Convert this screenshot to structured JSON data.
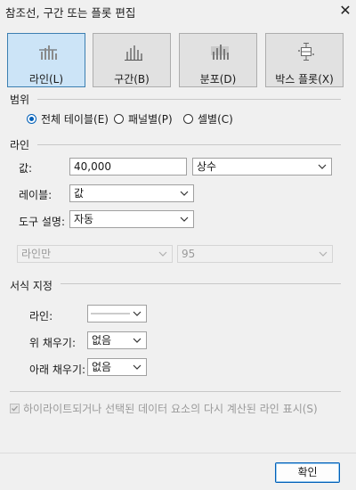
{
  "dialog": {
    "title": "참조선, 구간 또는 플롯 편집",
    "close_glyph": "✕"
  },
  "types": [
    {
      "label": "라인(L)",
      "icon": "line-chart-icon",
      "selected": true
    },
    {
      "label": "구간(B)",
      "icon": "band-chart-icon",
      "selected": false
    },
    {
      "label": "분포(D)",
      "icon": "distribution-chart-icon",
      "selected": false
    },
    {
      "label": "박스 플롯(X)",
      "icon": "box-plot-icon",
      "selected": false
    }
  ],
  "scope": {
    "heading": "범위",
    "options": [
      {
        "label": "전체 테이블(E)",
        "selected": true
      },
      {
        "label": "패널별(P)",
        "selected": false
      },
      {
        "label": "셀별(C)",
        "selected": false
      }
    ]
  },
  "line": {
    "heading": "라인",
    "value_label": "값:",
    "value": "40,000",
    "value_type": "상수",
    "label_label": "레이블:",
    "label_value": "값",
    "tooltip_label": "도구 설명:",
    "tooltip_value": "자동",
    "line_only": "라인만",
    "confidence": "95"
  },
  "format": {
    "heading": "서식 지정",
    "line_label": "라인:",
    "fill_above_label": "위 채우기:",
    "fill_above_value": "없음",
    "fill_below_label": "아래 채우기:",
    "fill_below_value": "없음"
  },
  "recalc": {
    "label": "하이라이트되거나 선택된 데이터 요소의 다시 계산된 라인 표시(S)",
    "checked": true,
    "disabled": true
  },
  "ok_label": "확인",
  "colors": {
    "accent": "#005fb8",
    "selected_bg": "#cce4f7",
    "selected_border": "#3c7fb1",
    "icon_gray": "#888888"
  }
}
